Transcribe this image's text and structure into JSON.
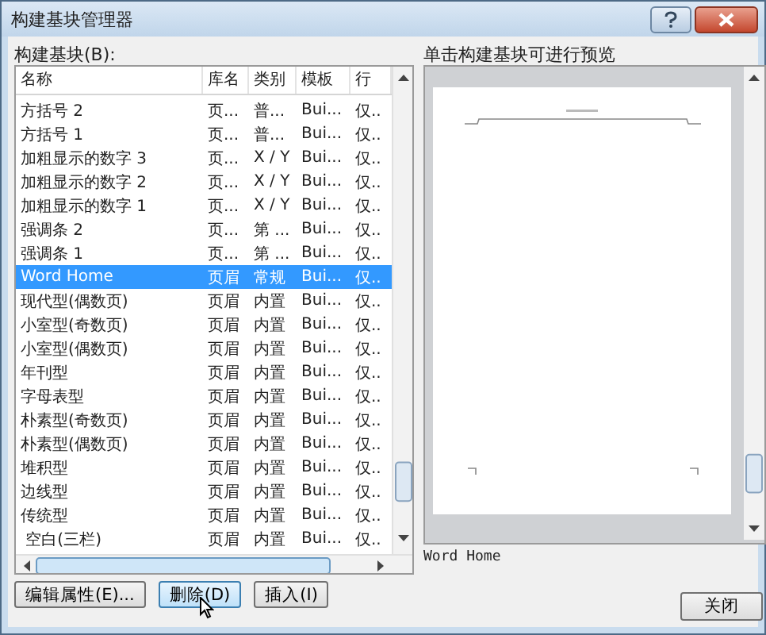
{
  "window": {
    "title": "构建基块管理器"
  },
  "list": {
    "label": "构建基块(B):",
    "columns": [
      "名称",
      "库名",
      "类别",
      "模板",
      "行"
    ],
    "rows": [
      {
        "cells": [
          "方括号 2",
          "页...",
          "普...",
          "Bui...",
          "仅.."
        ],
        "selected": false
      },
      {
        "cells": [
          "方括号 1",
          "页...",
          "普...",
          "Bui...",
          "仅.."
        ],
        "selected": false
      },
      {
        "cells": [
          "加粗显示的数字 3",
          "页...",
          "X / Y",
          "Bui...",
          "仅.."
        ],
        "selected": false
      },
      {
        "cells": [
          "加粗显示的数字 2",
          "页...",
          "X / Y",
          "Bui...",
          "仅.."
        ],
        "selected": false
      },
      {
        "cells": [
          "加粗显示的数字 1",
          "页...",
          "X / Y",
          "Bui...",
          "仅.."
        ],
        "selected": false
      },
      {
        "cells": [
          "强调条 2",
          "页...",
          "第 ...",
          "Bui...",
          "仅.."
        ],
        "selected": false
      },
      {
        "cells": [
          "强调条 1",
          "页...",
          "第 ...",
          "Bui...",
          "仅.."
        ],
        "selected": false
      },
      {
        "cells": [
          "Word Home",
          "页眉",
          "常规",
          "Bui...",
          "仅.."
        ],
        "selected": true
      },
      {
        "cells": [
          "现代型(偶数页)",
          "页眉",
          "内置",
          "Bui...",
          "仅.."
        ],
        "selected": false
      },
      {
        "cells": [
          "小室型(奇数页)",
          "页眉",
          "内置",
          "Bui...",
          "仅.."
        ],
        "selected": false
      },
      {
        "cells": [
          "小室型(偶数页)",
          "页眉",
          "内置",
          "Bui...",
          "仅.."
        ],
        "selected": false
      },
      {
        "cells": [
          "年刊型",
          "页眉",
          "内置",
          "Bui...",
          "仅.."
        ],
        "selected": false
      },
      {
        "cells": [
          "字母表型",
          "页眉",
          "内置",
          "Bui...",
          "仅.."
        ],
        "selected": false
      },
      {
        "cells": [
          "朴素型(奇数页)",
          "页眉",
          "内置",
          "Bui...",
          "仅.."
        ],
        "selected": false
      },
      {
        "cells": [
          "朴素型(偶数页)",
          "页眉",
          "内置",
          "Bui...",
          "仅.."
        ],
        "selected": false
      },
      {
        "cells": [
          "堆积型",
          "页眉",
          "内置",
          "Bui...",
          "仅.."
        ],
        "selected": false
      },
      {
        "cells": [
          "边线型",
          "页眉",
          "内置",
          "Bui...",
          "仅.."
        ],
        "selected": false
      },
      {
        "cells": [
          "传统型",
          "页眉",
          "内置",
          "Bui...",
          "仅.."
        ],
        "selected": false
      },
      {
        "cells": [
          " 空白(三栏)",
          "页眉",
          "内置",
          "Bui...",
          "仅.."
        ],
        "selected": false
      }
    ]
  },
  "buttons": [
    {
      "label": "编辑属性(E)...",
      "hovered": false
    },
    {
      "label": "删除(D)",
      "hovered": true
    },
    {
      "label": "插入(I)",
      "hovered": false
    }
  ],
  "preview": {
    "label": "单击构建基块可进行预览",
    "caption": "Word Home"
  },
  "close_button": "关闭"
}
